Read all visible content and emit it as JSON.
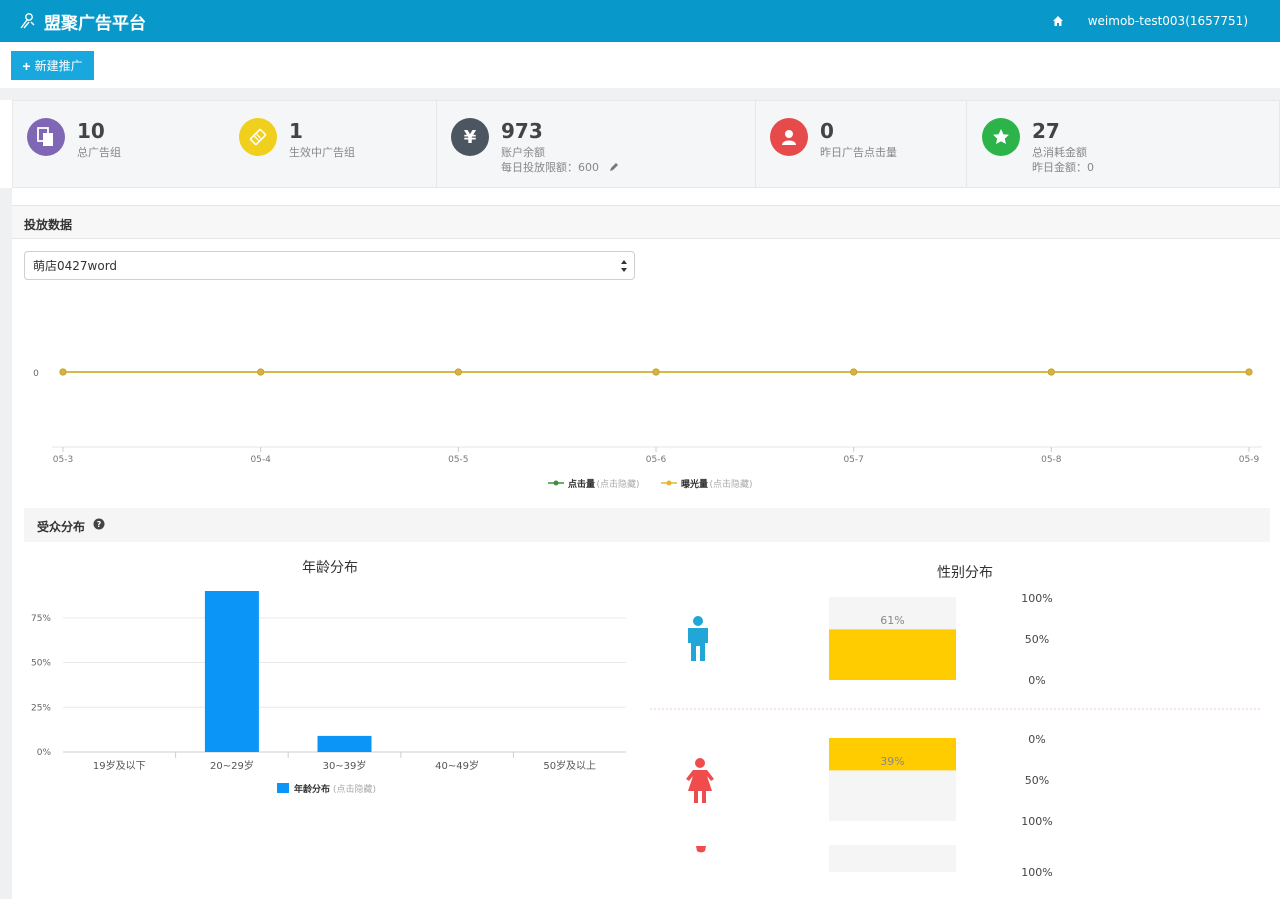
{
  "app": {
    "title": "盟聚广告平台",
    "user": "weimob-test003(1657751)"
  },
  "toolbar": {
    "new_label": "新建推广"
  },
  "stats": [
    {
      "value": "10",
      "label": "总广告组",
      "color": "#7f67b6",
      "icon": "document-icon"
    },
    {
      "value": "1",
      "label": "生效中广告组",
      "color": "#f1cf1d",
      "icon": "ticket-icon"
    },
    {
      "value": "973",
      "label": "账户余额",
      "sub": "每日投放限额：600",
      "color": "#4c5661",
      "icon": "yen-icon"
    },
    {
      "value": "0",
      "label": "昨日广告点击量",
      "color": "#e64a4a",
      "icon": "user-icon"
    },
    {
      "value": "27",
      "label": "总消耗金额",
      "sub": "昨日金额：0",
      "color": "#2cb34a",
      "icon": "star-icon"
    }
  ],
  "delivery": {
    "title": "投放数据",
    "select_value": "萌店0427word"
  },
  "chart_data": [
    {
      "type": "line",
      "x": [
        "05-3",
        "05-4",
        "05-5",
        "05-6",
        "05-7",
        "05-8",
        "05-9"
      ],
      "yticks": [
        "0"
      ],
      "series": [
        {
          "name": "点击量",
          "values": [
            0,
            0,
            0,
            0,
            0,
            0,
            0
          ],
          "color": "#3f8f3f"
        },
        {
          "name": "曝光量",
          "values": [
            0,
            0,
            0,
            0,
            0,
            0,
            0
          ],
          "color": "#e8b52a"
        }
      ],
      "legend_hint": "(点击隐藏)",
      "legend_position": "bottom"
    },
    {
      "type": "bar",
      "title": "年龄分布",
      "categories": [
        "19岁及以下",
        "20~29岁",
        "30~39岁",
        "40~49岁",
        "50岁及以上"
      ],
      "series": [
        {
          "name": "年龄分布",
          "values": [
            0,
            90,
            9,
            0,
            0
          ],
          "color": "#0b95f7"
        }
      ],
      "yticks": [
        "0%",
        "25%",
        "50%",
        "75%"
      ],
      "ylim": [
        0,
        90
      ],
      "legend_hint": "(点击隐藏)",
      "legend_position": "bottom"
    },
    {
      "type": "bar",
      "title": "性别分布",
      "categories": [
        "男",
        "女"
      ],
      "values": [
        61,
        39
      ],
      "value_labels": [
        "61%",
        "39%"
      ],
      "scale_labels": [
        "100%",
        "50%",
        "0%"
      ],
      "bar_color": "#ffcc00",
      "male_color": "#21a6d8",
      "female_color": "#ef4d4d"
    }
  ]
}
